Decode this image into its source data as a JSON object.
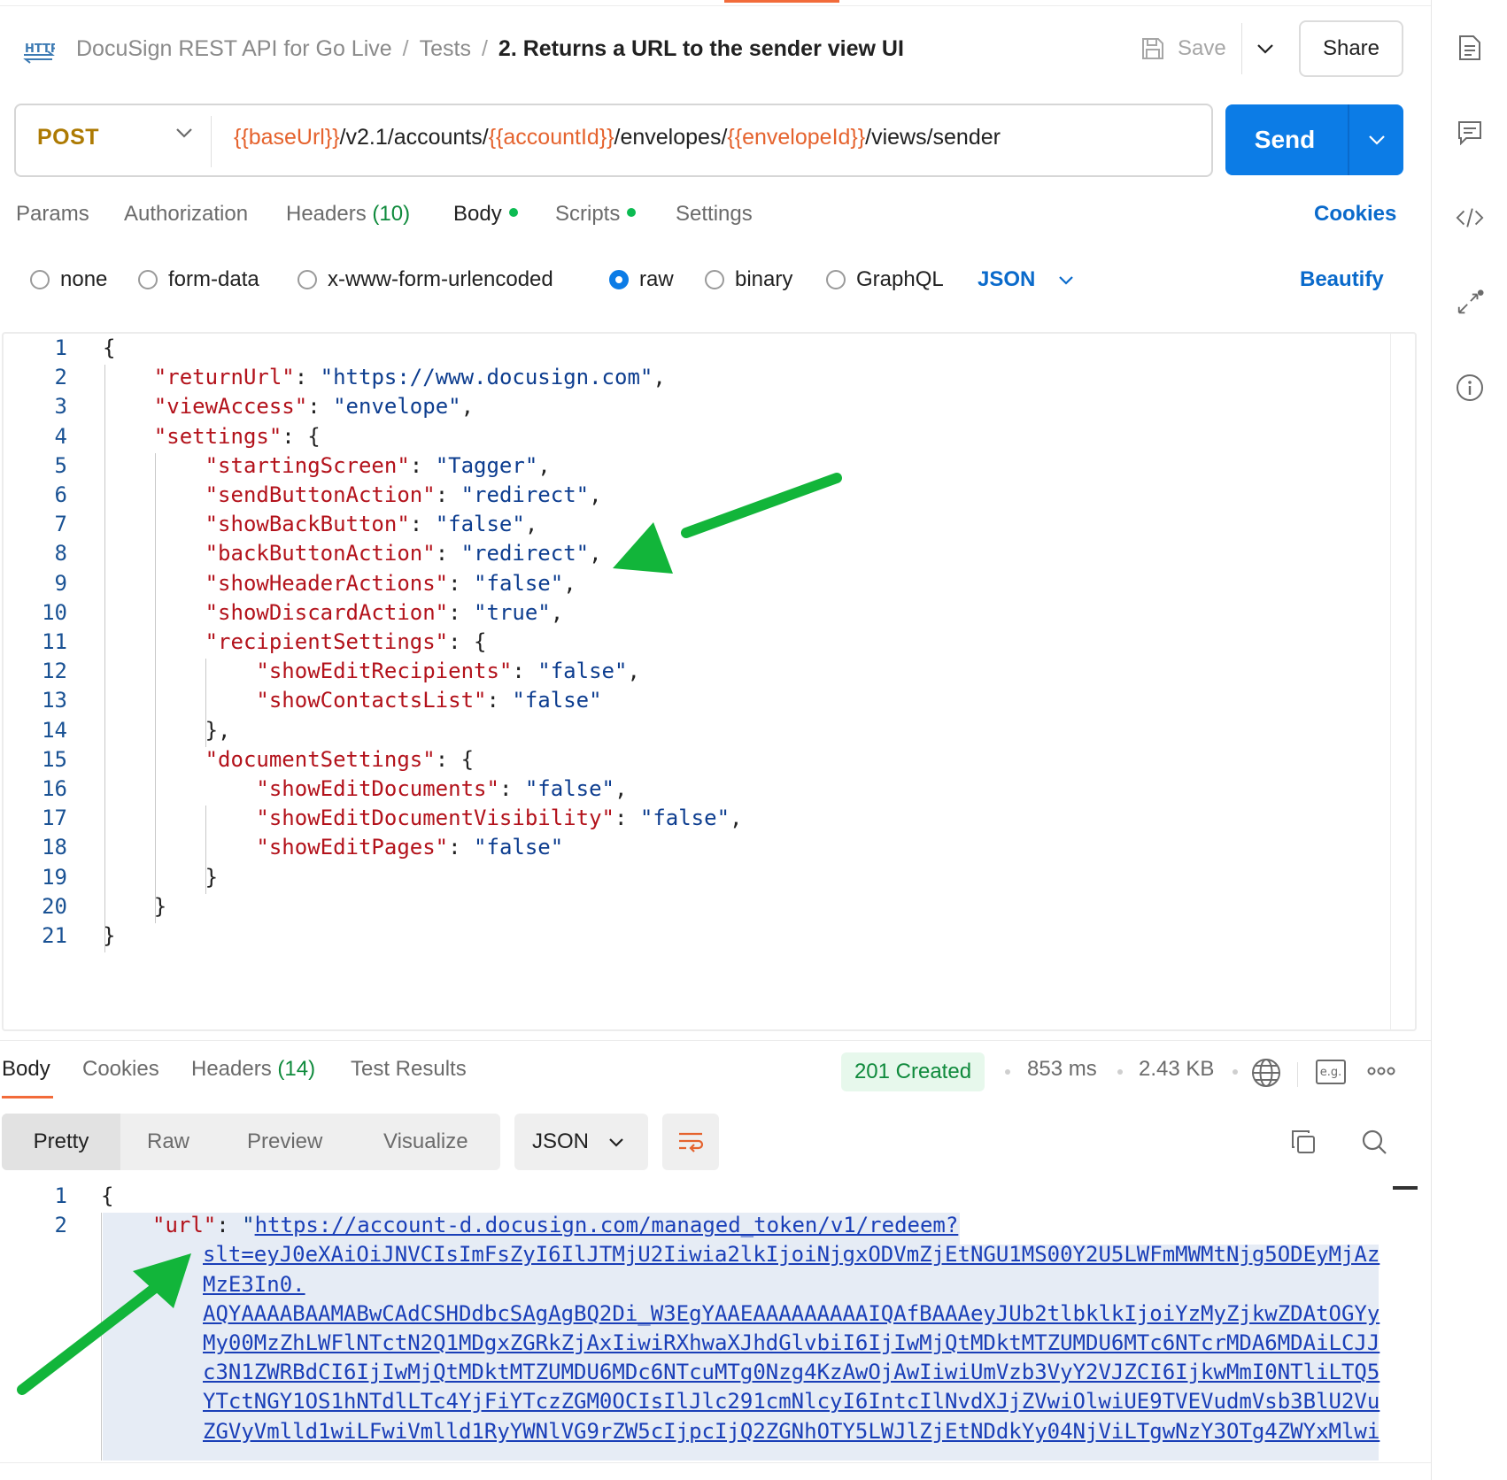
{
  "header": {
    "breadcrumb": [
      "DocuSign REST API for Go Live",
      "Tests",
      "2. Returns a URL to the sender view UI"
    ],
    "http_badge": "HTTP",
    "save_label": "Save",
    "share_label": "Share"
  },
  "request": {
    "method": "POST",
    "url_parts": [
      {
        "text": "{{baseUrl}}",
        "var": true
      },
      {
        "text": "/v2.1/accounts/",
        "var": false
      },
      {
        "text": "{{accountId}}",
        "var": true
      },
      {
        "text": "/envelopes/",
        "var": false
      },
      {
        "text": "{{envelopeId}}",
        "var": true
      },
      {
        "text": "/views/sender",
        "var": false
      }
    ],
    "send_label": "Send"
  },
  "tabs": {
    "params": "Params",
    "authorization": "Authorization",
    "headers": "Headers",
    "headers_count": "(10)",
    "body": "Body",
    "scripts": "Scripts",
    "settings": "Settings",
    "cookies": "Cookies",
    "active": "Body"
  },
  "body_types": {
    "options": [
      "none",
      "form-data",
      "x-www-form-urlencoded",
      "raw",
      "binary",
      "GraphQL"
    ],
    "selected": "raw",
    "format": "JSON",
    "beautify": "Beautify"
  },
  "request_body_lines": [
    "{",
    "    \"returnUrl\": \"https://www.docusign.com\",",
    "    \"viewAccess\": \"envelope\",",
    "    \"settings\": {",
    "        \"startingScreen\": \"Tagger\",",
    "        \"sendButtonAction\": \"redirect\",",
    "        \"showBackButton\": \"false\",",
    "        \"backButtonAction\": \"redirect\",",
    "        \"showHeaderActions\": \"false\",",
    "        \"showDiscardAction\": \"true\",",
    "        \"recipientSettings\": {",
    "            \"showEditRecipients\": \"false\",",
    "            \"showContactsList\": \"false\"",
    "        },",
    "        \"documentSettings\": {",
    "            \"showEditDocuments\": \"false\",",
    "            \"showEditDocumentVisibility\": \"false\",",
    "            \"showEditPages\": \"false\"",
    "        }",
    "    }",
    "}"
  ],
  "response": {
    "tabs": {
      "body": "Body",
      "cookies": "Cookies",
      "headers": "Headers",
      "headers_count": "(14)",
      "test_results": "Test Results",
      "active": "Body"
    },
    "status": "201 Created",
    "time": "853 ms",
    "size": "2.43 KB",
    "example_label": "e.g.",
    "formats": [
      "Pretty",
      "Raw",
      "Preview",
      "Visualize"
    ],
    "active_format": "Pretty",
    "language": "JSON",
    "line_numbers": [
      "1",
      "2"
    ],
    "lines": {
      "open": "{",
      "key": "\"url\"",
      "colon": ": ",
      "quote": "\"",
      "url_wrapped": [
        "https://account-d.docusign.com/managed_token/v1/redeem?",
        "slt=eyJ0eXAiOiJNVCIsImFsZyI6IlJTMjU2Iiwia2lkIjoiNjgxODVmZjEtNGU1MS00Y2U5LWFmMWMtNjg5ODEyMjAz",
        "MzE3In0.",
        "AQYAAAABAAMABwCAdCSHDdbcSAgAgBQ2Di_W3EgYAAEAAAAAAAAAIQAfBAAAeyJUb2tlbklkIjoiYzMyZjkwZDAtOGYy",
        "My00MzZhLWFlNTctN2Q1MDgxZGRkZjAxIiwiRXhwaXJhdGlvbiI6IjIwMjQtMDktMTZUMDU6MTc6NTcrMDA6MDAiLCJJ",
        "c3N1ZWRBdCI6IjIwMjQtMDktMTZUMDU6MDc6NTcuMTg0Nzg4KzAwOjAwIiwiUmVzb3VyY2VJZCI6IjkwMmI0NTliLTQ5",
        "YTctNGY1OS1hNTdlLTc4YjFiYTczZGM0OCIsIlJlc291cmNlcyI6IntcIlNvdXJjZVwiOlwiUE9TVEVudmVsb3BlU2Vu",
        "ZGVyVmlld1wiLFwiVmlld1RyYWNlVG9rZW5cIjpcIjQ2ZGNhOTY5LWJlZjEtNDdkYy04NjViLTgwNzY3OTg4ZWYxMlwi"
      ]
    }
  },
  "colors": {
    "accent": "#f26b3a",
    "send": "#0c7ce6",
    "link": "#0a6acb",
    "method": "#ad7a03",
    "variable": "#e5632e",
    "status_bg": "#e7f8ec",
    "status_fg": "#0f8a3c",
    "arrow": "#12b53a"
  },
  "sidebar_icons": [
    "documentation-icon",
    "comments-icon",
    "code-icon",
    "related-collections-icon",
    "info-icon"
  ]
}
